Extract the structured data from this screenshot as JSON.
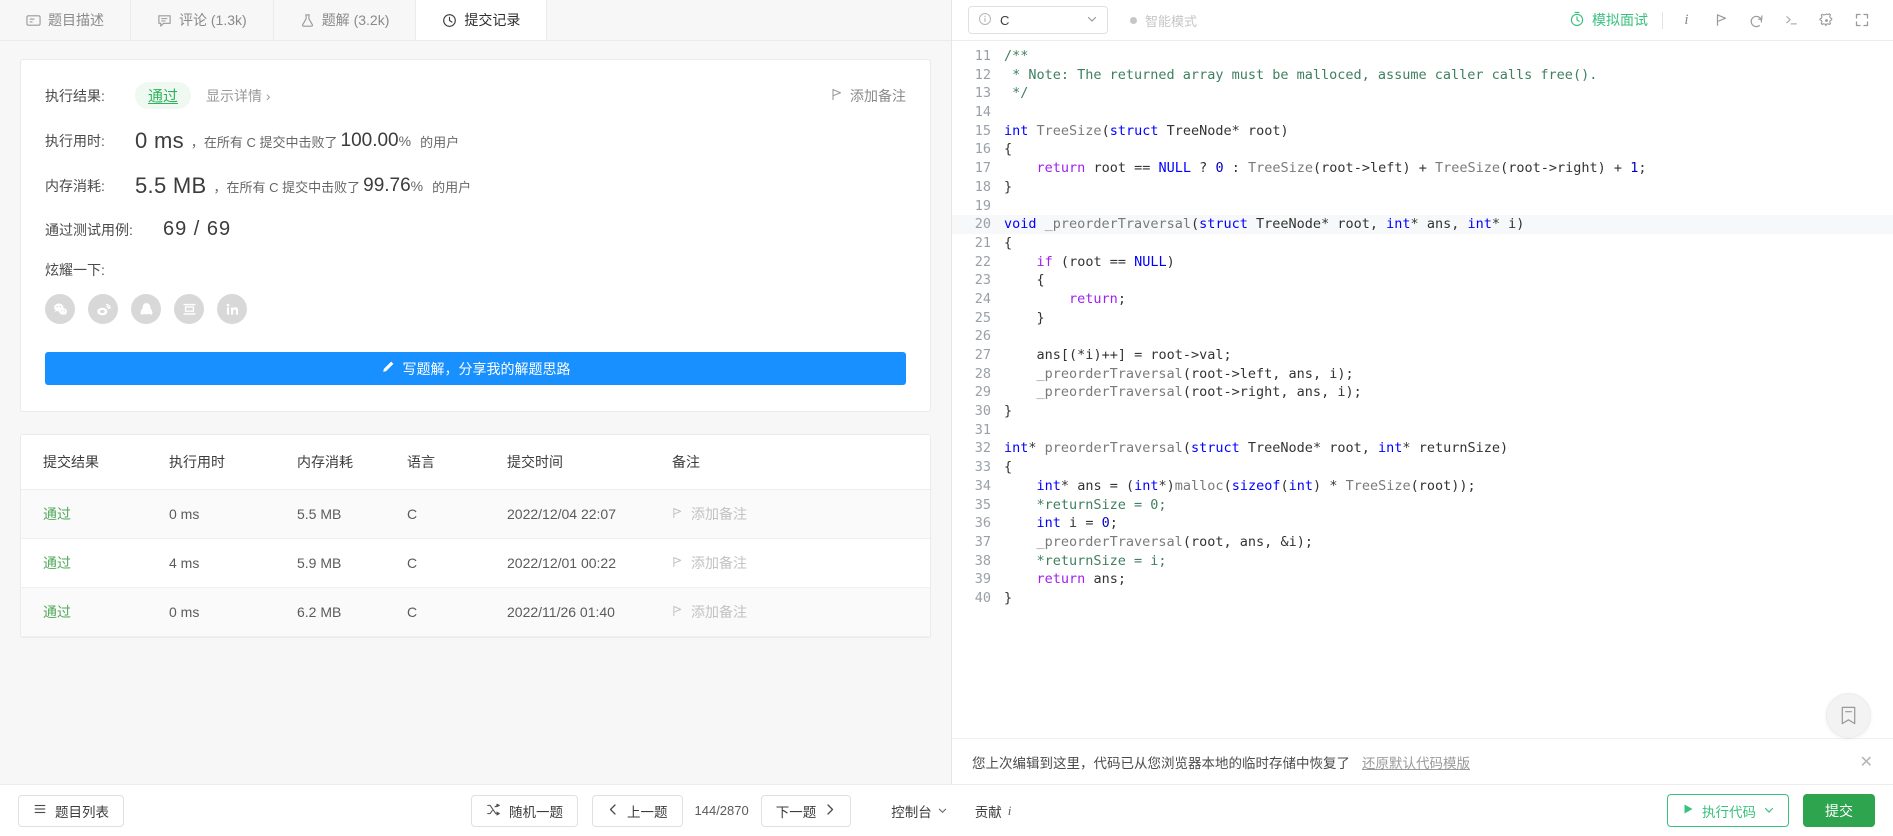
{
  "left": {
    "tabs": [
      {
        "id": "description",
        "label": "题目描述",
        "icon": "description-icon",
        "active": false
      },
      {
        "id": "comments",
        "label": "评论 (1.3k)",
        "icon": "comment-icon",
        "active": false
      },
      {
        "id": "solutions",
        "label": "题解 (3.2k)",
        "icon": "flask-icon",
        "active": false
      },
      {
        "id": "submissions",
        "label": "提交记录",
        "icon": "clock-icon",
        "active": true
      }
    ],
    "result": {
      "result_label": "执行结果:",
      "status": "通过",
      "detail_link": "显示详情 ›",
      "add_note": "添加备注",
      "runtime_label": "执行用时:",
      "runtime_value": "0 ms",
      "runtime_mid": "，在所有 C 提交中击败了",
      "runtime_pct": "100.00",
      "pct_symbol": "%",
      "users_suffix": "的用户",
      "memory_label": "内存消耗:",
      "memory_value": "5.5 MB",
      "memory_mid": "，在所有 C 提交中击败了",
      "memory_pct": "99.76",
      "cases_label": "通过测试用例:",
      "cases_value": "69 / 69",
      "share_label": "炫耀一下:",
      "socials": [
        "wechat-icon",
        "weibo-icon",
        "qq-icon",
        "douban-icon",
        "linkedin-icon"
      ],
      "write_button": "写题解，分享我的解题思路"
    },
    "table": {
      "headers": [
        "提交结果",
        "执行用时",
        "内存消耗",
        "语言",
        "提交时间",
        "备注"
      ],
      "rows": [
        {
          "status": "通过",
          "runtime": "0 ms",
          "memory": "5.5 MB",
          "lang": "C",
          "time": "2022/12/04 22:07",
          "note": "添加备注"
        },
        {
          "status": "通过",
          "runtime": "4 ms",
          "memory": "5.9 MB",
          "lang": "C",
          "time": "2022/12/01 00:22",
          "note": "添加备注"
        },
        {
          "status": "通过",
          "runtime": "0 ms",
          "memory": "6.2 MB",
          "lang": "C",
          "time": "2022/11/26 01:40",
          "note": "添加备注"
        }
      ]
    }
  },
  "editor": {
    "language": "C",
    "smart_mode": "智能模式",
    "mock_interview": "模拟面试",
    "tools": [
      "info-icon",
      "flag-icon",
      "undo-icon",
      "terminal-icon",
      "gear-icon",
      "fullscreen-icon"
    ],
    "restore_text": "您上次编辑到这里，代码已从您浏览器本地的临时存储中恢复了",
    "restore_link": "还原默认代码模版",
    "first_line": 11,
    "highlight_line": 20,
    "lines": [
      "/**",
      " * Note: The returned array must be malloced, assume caller calls free().",
      " */",
      "",
      "int TreeSize(struct TreeNode* root)",
      "{",
      "    return root == NULL ? 0 : TreeSize(root->left) + TreeSize(root->right) + 1;",
      "}",
      "",
      "void _preorderTraversal(struct TreeNode* root, int* ans, int* i)",
      "{",
      "    if (root == NULL)",
      "    {",
      "        return;",
      "    }",
      "",
      "    ans[(*i)++] = root->val;",
      "    _preorderTraversal(root->left, ans, i);",
      "    _preorderTraversal(root->right, ans, i);",
      "}",
      "",
      "int* preorderTraversal(struct TreeNode* root, int* returnSize)",
      "{",
      "    int* ans = (int*)malloc(sizeof(int) * TreeSize(root));",
      "    *returnSize = 0;",
      "    int i = 0;",
      "    _preorderTraversal(root, ans, &i);",
      "    *returnSize = i;",
      "    return ans;",
      "}"
    ]
  },
  "footer": {
    "problem_list": "题目列表",
    "random": "随机一题",
    "prev": "上一题",
    "counter": "144/2870",
    "next": "下一题",
    "console": "控制台",
    "contribute": "贡献",
    "contribute_sub": "i",
    "run": "执行代码",
    "submit": "提交"
  },
  "colors": {
    "primary_blue": "#1890ff",
    "green": "#2ea44f",
    "pass_green": "#52aa5c",
    "mock_green": "#3ac07d"
  }
}
